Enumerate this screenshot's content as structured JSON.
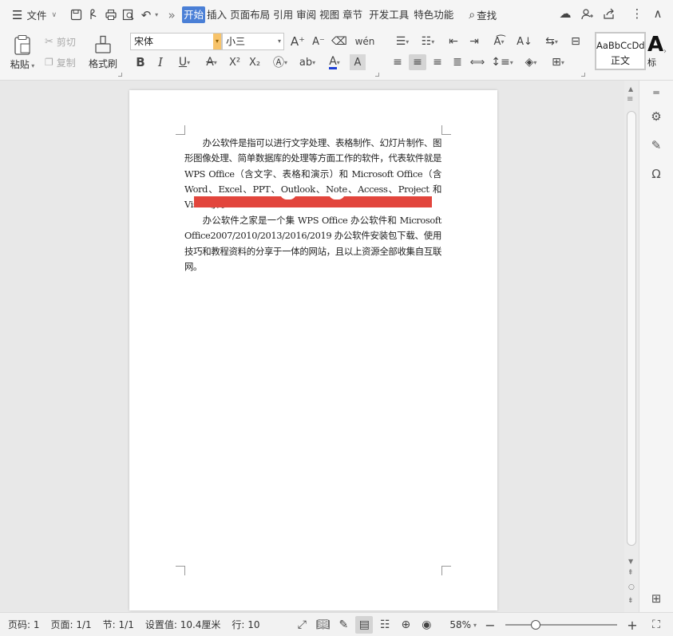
{
  "menubar": {
    "file": "文件",
    "tabs": [
      {
        "label": "开始",
        "active": true
      },
      {
        "label": "插入",
        "active": false
      },
      {
        "label": "页面布局",
        "active": false
      },
      {
        "label": "引用",
        "active": false
      },
      {
        "label": "审阅",
        "active": false
      },
      {
        "label": "视图",
        "active": false
      },
      {
        "label": "章节",
        "active": false
      },
      {
        "label": "开发工具",
        "active": false
      },
      {
        "label": "特色功能",
        "active": false
      }
    ],
    "search": "查找",
    "more": "»"
  },
  "ribbon": {
    "paste": "粘贴",
    "cut": "剪切",
    "copy": "复制",
    "format_painter": "格式刷",
    "font_name": "宋体",
    "font_size": "小三",
    "style_sample": "AaBbCcDd",
    "style_name": "正文",
    "style_next_sample": "A",
    "style_next_name": "标"
  },
  "document": {
    "paragraph1": "办公软件是指可以进行文字处理、表格制作、幻灯片制作、图形图像处理、简单数据库的处理等方面工作的软件，代表软件就是 WPS Office（含文字、表格和演示）和 Microsoft Office（含 Word、Excel、PPT、Outlook、Note、Access、Project 和 Visio 等）。",
    "paragraph2": "办公软件之家是一个集 WPS Office 办公软件和 Microsoft Office2007/2010/2013/2016/2019 办公软件安装包下载、使用技巧和教程资料的分享于一体的网站，且以上资源全部收集自互联网。"
  },
  "statusbar": {
    "page_num": "页码: 1",
    "page_count": "页面: 1/1",
    "section": "节: 1/1",
    "setting": "设置值: 10.4厘米",
    "line": "行: 10",
    "zoom": "58%",
    "zoom_fraction": 0.27
  },
  "colors": {
    "accent": "#4a7fd6",
    "red_bar": "#e2453c"
  }
}
